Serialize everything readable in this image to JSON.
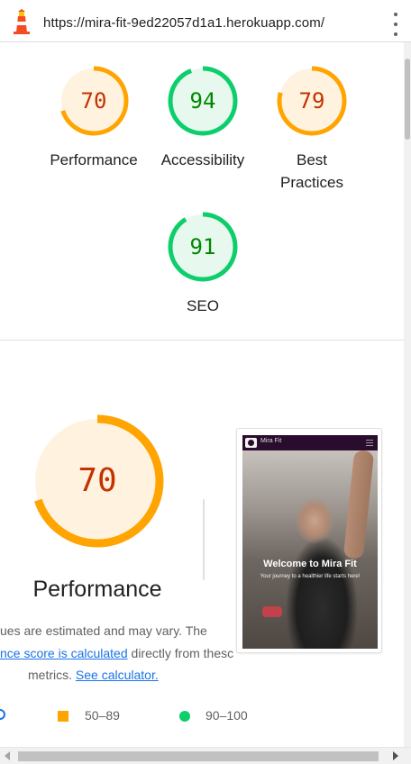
{
  "browser": {
    "url": "https://mira-fit-9ed22057d1a1.herokuapp.com/",
    "site_icon": "lighthouse-icon",
    "menu_icon": "vertical-dots-icon"
  },
  "summary": {
    "gauges": [
      {
        "label": "Performance",
        "score": 70,
        "color": "#ffa400",
        "text_color": "#c33300",
        "fill": "#fff3e0"
      },
      {
        "label": "Accessibility",
        "score": 94,
        "color": "#0cce6b",
        "text_color": "#008800",
        "fill": "#e7f8ee"
      },
      {
        "label": "Best Practices",
        "label_line1": "Best",
        "label_line2": "Practices",
        "score": 79,
        "color": "#ffa400",
        "text_color": "#c33300",
        "fill": "#fff3e0"
      },
      {
        "label": "SEO",
        "score": 91,
        "color": "#0cce6b",
        "text_color": "#008800",
        "fill": "#e7f8ee"
      }
    ]
  },
  "performance": {
    "score": 70,
    "title": "Performance",
    "color": "#ffa400",
    "description_line1": "ues are estimated and may vary. The",
    "description_link": "nce score is calculated",
    "description_line2_rest": " directly from thesc",
    "description_line3": "metrics. ",
    "calculator_link": "See calculator."
  },
  "screenshot": {
    "brand": "Mira Fit",
    "hero_title": "Welcome to Mira Fit",
    "hero_subtitle": "Your journey to a healthier life starts here!"
  },
  "legend": {
    "average": "50–89",
    "good": "90–100"
  }
}
